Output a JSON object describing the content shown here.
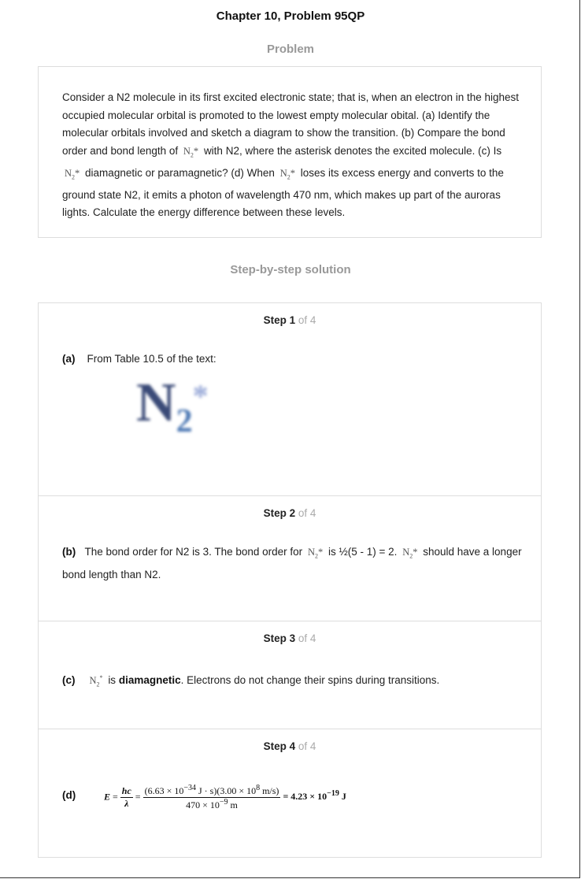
{
  "title": "Chapter 10, Problem 95QP",
  "problem_heading": "Problem",
  "problem": {
    "p1": "Consider a N2 molecule in its first excited electronic state; that is, when an electron in the highest occupied molecular orbital is promoted to the lowest empty molecular obital. (a) Identify the molecular orbitals involved and sketch a diagram to show the transition. (b) Compare the bond order and bond length of",
    "p2": "with N2, where the asterisk denotes the excited molecule. (c) Is",
    "p3": "diamagnetic or paramagnetic? (d) When",
    "p4": "loses its excess energy and converts to the ground state N2, it emits a photon of wavelength 470 nm, which makes up part of the auroras lights. Calculate the energy difference between these levels."
  },
  "solution_heading": "Step-by-step solution",
  "of_label": "of 4",
  "steps": [
    {
      "label": "Step",
      "num": "1",
      "part": "(a)",
      "text": "From Table 10.5 of the text:"
    },
    {
      "label": "Step",
      "num": "2",
      "part": "(b)",
      "t1": "The bond order for N2 is 3. The bond order for",
      "t2": "is ½(5 - 1) = 2.",
      "t3": "should have a longer bond length than N2."
    },
    {
      "label": "Step",
      "num": "3",
      "part": "(c)",
      "t1": "is",
      "bold": "diamagnetic",
      "t2": ". Electrons do not change their spins during transitions."
    },
    {
      "label": "Step",
      "num": "4",
      "part": "(d)"
    }
  ],
  "chem": {
    "n": "N",
    "sub": "2",
    "star": "*"
  },
  "formula": {
    "lhs": "E",
    "eq": "=",
    "hc": "hc",
    "lambda": "λ",
    "num": "(6.63 × 10",
    "exp1": "−34",
    "num2": " J · s)(3.00 × 10",
    "exp2": "8",
    "num3": " m/s)",
    "den": "470 × 10",
    "exp3": "−9",
    "den2": " m",
    "result": "= 4.23 × 10",
    "exp4": "−19",
    "result2": " J"
  }
}
